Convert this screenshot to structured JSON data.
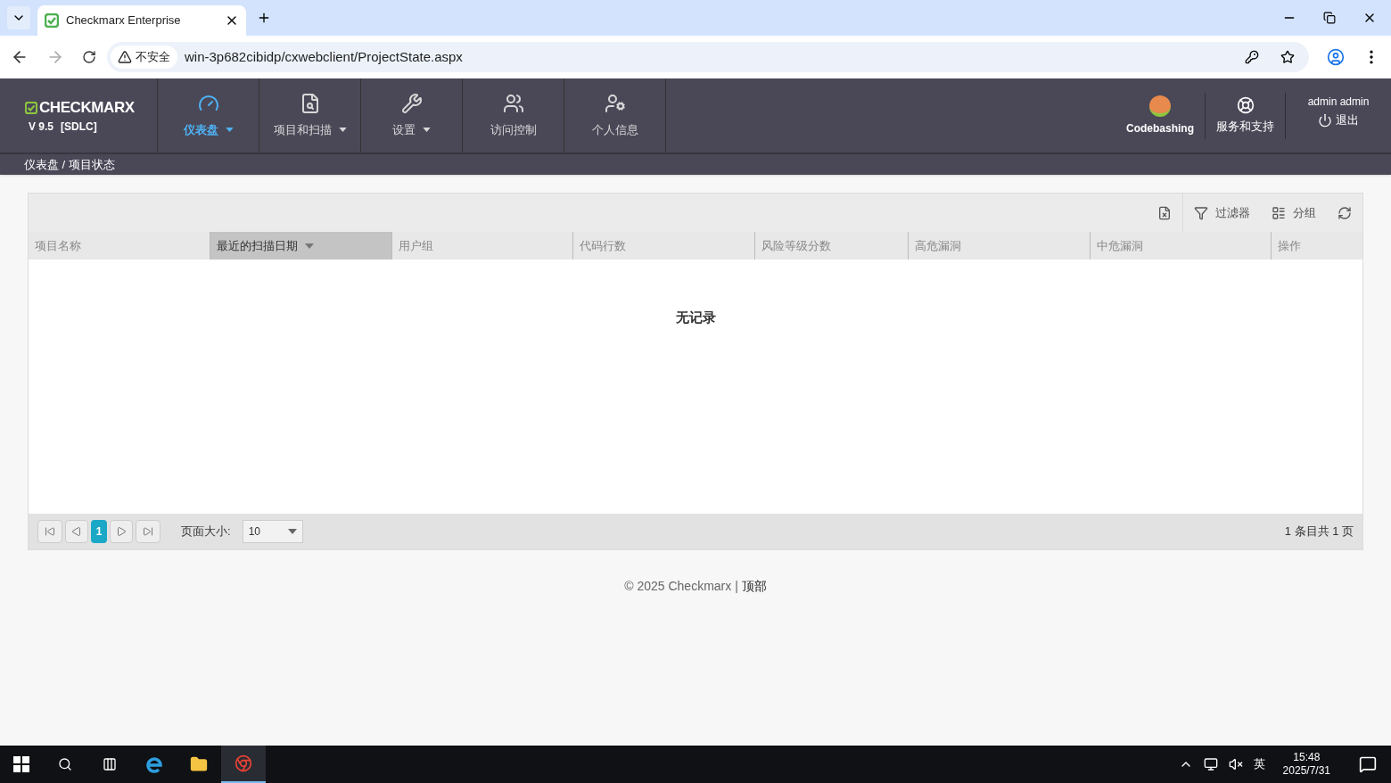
{
  "browser": {
    "tab_title": "Checkmarx Enterprise",
    "security_label": "不安全",
    "url": "win-3p682cibidp/cxwebclient/ProjectState.aspx"
  },
  "header": {
    "logo": "CHECKMARX",
    "version": "V 9.5",
    "edition": "[SDLC]",
    "nav": [
      {
        "label": "仪表盘",
        "selected": true,
        "dropdown": true,
        "kind": "gauge"
      },
      {
        "label": "项目和扫描",
        "selected": false,
        "dropdown": true,
        "kind": "search"
      },
      {
        "label": "设置",
        "selected": false,
        "dropdown": true,
        "kind": "wrench"
      },
      {
        "label": "访问控制",
        "selected": false,
        "dropdown": false,
        "kind": "access"
      },
      {
        "label": "个人信息",
        "selected": false,
        "dropdown": false,
        "kind": "profile"
      }
    ],
    "codebashing": "Codebashing",
    "support": "服务和支持",
    "user": "admin admin",
    "logout": "退出"
  },
  "breadcrumb": "仪表盘 / 项目状态",
  "grid": {
    "toolbar": {
      "filter": "过滤器",
      "group": "分组"
    },
    "columns": [
      {
        "label": "项目名称",
        "selected": false
      },
      {
        "label": "最近的扫描日期",
        "selected": true
      },
      {
        "label": "用户组",
        "selected": false
      },
      {
        "label": "代码行数",
        "selected": false
      },
      {
        "label": "风险等级分数",
        "selected": false
      },
      {
        "label": "高危漏洞",
        "selected": false
      },
      {
        "label": "中危漏洞",
        "selected": false
      },
      {
        "label": "操作",
        "selected": false
      }
    ],
    "empty": "无记录",
    "pager": {
      "current_page": "1",
      "page_size_label": "页面大小:",
      "page_size": "10",
      "summary": "1 条目共 1 页"
    }
  },
  "footer": {
    "copyright": "© 2025 Checkmarx |",
    "top_link": "顶部"
  },
  "taskbar": {
    "ime": "英",
    "time": "15:48",
    "date": "2025/7/31"
  }
}
